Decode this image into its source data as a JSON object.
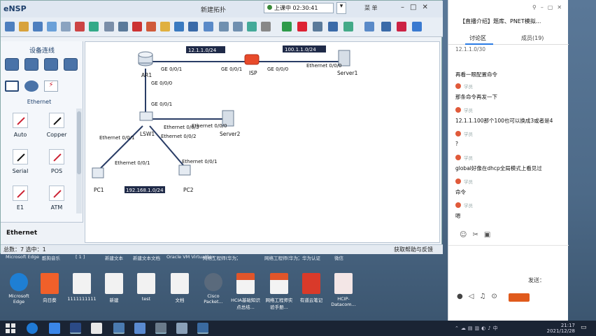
{
  "ensp": {
    "logo": "eNSP",
    "window_title": "新建拓扑",
    "class_timer": "上课中 02:30:41",
    "menu_label": "菜 单",
    "panel_title": "设备连线",
    "ethernet_label": "Ethernet",
    "devices": [
      {
        "label": "Auto",
        "style": "red"
      },
      {
        "label": "Copper",
        "style": "black"
      },
      {
        "label": "Serial",
        "style": "black"
      },
      {
        "label": "POS",
        "style": "red"
      },
      {
        "label": "E1",
        "style": "red"
      },
      {
        "label": "ATM",
        "style": "red"
      }
    ],
    "panel_footer": "Ethernet",
    "status_left": "总数：7 选中：1",
    "status_right": "获取帮助与反馈"
  },
  "topology": {
    "nodes": {
      "ar1": "AR1",
      "isp": "ISP",
      "server1": "Server1",
      "lsw1": "LSW1",
      "server2": "Server2",
      "pc1": "PC1",
      "pc2": "PC2"
    },
    "notes": {
      "ar_isp_net": "12.1.1.0/24",
      "isp_server_net": "100.1.1.0/24",
      "lan_net": "192.168.1.0/24"
    },
    "ports": {
      "ar1_isp": "GE 0/0/1",
      "isp_ar1": "GE 0/0/1",
      "isp_server1": "GE 0/0/0",
      "server1_isp": "Ethernet 0/0/0",
      "ar1_lsw1": "GE 0/0/0",
      "lsw1_ar1": "GE 0/0/1",
      "lsw1_server2": "Ethernet 0/0/3",
      "server2_lsw1": "Ethernet 0/0/0",
      "lsw1_pc1": "Ethernet 0/0/1",
      "lsw1_pc2": "Ethernet 0/0/2",
      "pc1_lsw1": "Ethernet 0/0/1",
      "pc2_lsw1": "Ethernet 0/0/1"
    }
  },
  "chat": {
    "title": "【直播介绍】题库、PNET模拟...",
    "tab_discuss": "讨论区",
    "tab_members": "成员(19)",
    "messages": [
      {
        "name": "",
        "text": "12.1.1.0/30"
      },
      {
        "name": "",
        "text": "再看一眼配置命令"
      },
      {
        "name": "学员",
        "text": "那条命令再发一下"
      },
      {
        "name": "学员",
        "text": "12.1.1.100那个100也可以换成3或者是4"
      },
      {
        "name": "学员",
        "text": "?"
      },
      {
        "name": "学员",
        "text": "global好像在dhcp全局模式上看见过"
      },
      {
        "name": "学员",
        "text": "命令"
      },
      {
        "name": "学员",
        "text": "嗯"
      }
    ],
    "send_label": "发送："
  },
  "desktop": {
    "top_row": [
      "Microsoft Edge",
      "酷狗音乐",
      "[ 1 ]",
      "新建文本",
      "新建文本文档",
      "Oracle VM VirtualBox",
      "网络工程师(华为方向)",
      "网络工程师(华为方向)",
      "华为认证",
      "微信"
    ],
    "icons": [
      "Microsoft Edge",
      "向日葵",
      "1111111111",
      "新建",
      "test",
      "文档",
      "Cisco Packet...",
      "HCIA基础知识点总结...",
      "网络工程师实验手册...",
      "有道云笔记",
      "HCIP-Datacom..."
    ]
  },
  "taskbar": {
    "time": "21:17",
    "date": "2021/12/28",
    "ime": "中"
  }
}
